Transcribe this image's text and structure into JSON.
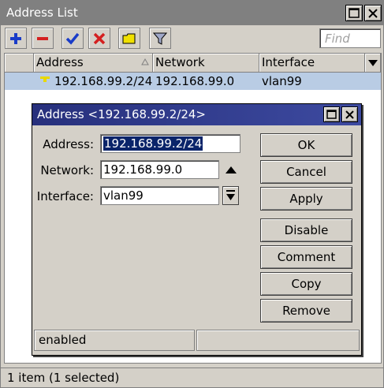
{
  "window": {
    "title": "Address List"
  },
  "toolbar": {
    "find_placeholder": "Find"
  },
  "list": {
    "columns": [
      "Address",
      "Network",
      "Interface"
    ],
    "rows": [
      {
        "address": "192.168.99.2/24",
        "network": "192.168.99.0",
        "interface": "vlan99"
      }
    ]
  },
  "status": {
    "text": "1 item (1 selected)"
  },
  "dialog": {
    "title": "Address <192.168.99.2/24>",
    "address_label": "Address:",
    "address_value": "192.168.99.2/24",
    "network_label": "Network:",
    "network_value": "192.168.99.0",
    "interface_label": "Interface:",
    "interface_value": "vlan99",
    "buttons": {
      "ok": "OK",
      "cancel": "Cancel",
      "apply": "Apply",
      "disable": "Disable",
      "comment": "Comment",
      "copy": "Copy",
      "remove": "Remove"
    },
    "status_text": "enabled"
  },
  "colors": {
    "selection_row": "#b9cce4",
    "dialog_title": "#2f3c8e",
    "add_icon": "#1a3cc8",
    "remove_icon": "#d42020",
    "enable_icon": "#1a3cc8",
    "disable_icon": "#d42020",
    "comment_icon": "#f0e000"
  }
}
